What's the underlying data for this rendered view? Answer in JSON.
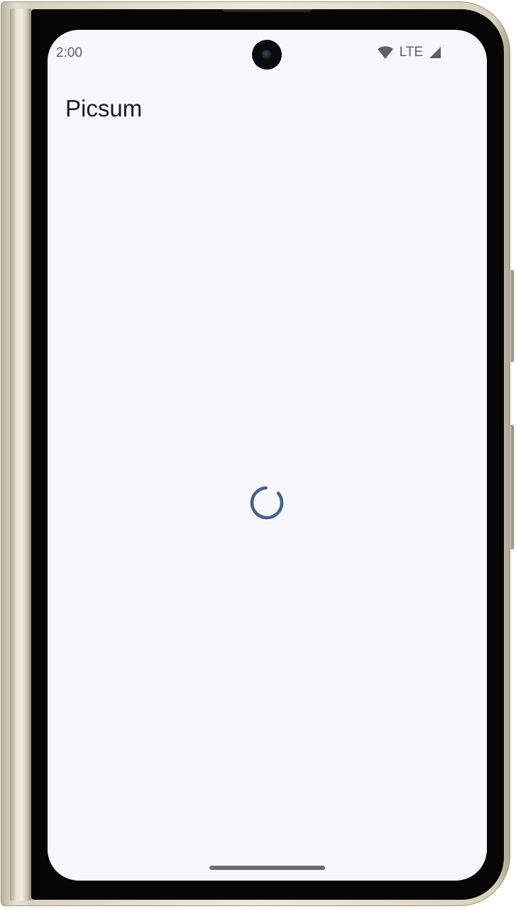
{
  "status_bar": {
    "time": "2:00",
    "network": "LTE",
    "icons": [
      "wifi-icon",
      "cellular-signal-icon"
    ]
  },
  "app_bar": {
    "title": "Picsum"
  },
  "content": {
    "state": "loading",
    "spinner_color": "#44618f"
  },
  "colors": {
    "background": "#f8f7fc",
    "status_text": "#5f5f66",
    "title_text": "#1b1b1f"
  }
}
